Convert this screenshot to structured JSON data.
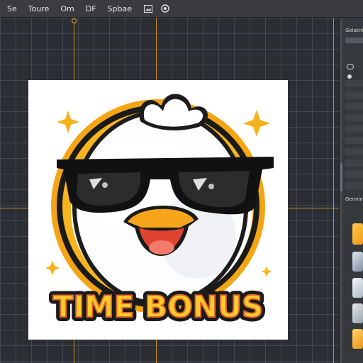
{
  "menubar": {
    "items": [
      "Se",
      "Toure",
      "Om",
      "DF",
      "Spbae"
    ]
  },
  "right_panel": {
    "title": "Gelatnid",
    "section2_title": "Genning"
  },
  "artwork": {
    "text": "TIME BONUS"
  },
  "colors": {
    "accent_orange": "#f2a81d",
    "guide": "#e59a2a",
    "canvas_bg": "#2b2e33",
    "panel_bg": "#35383d"
  }
}
